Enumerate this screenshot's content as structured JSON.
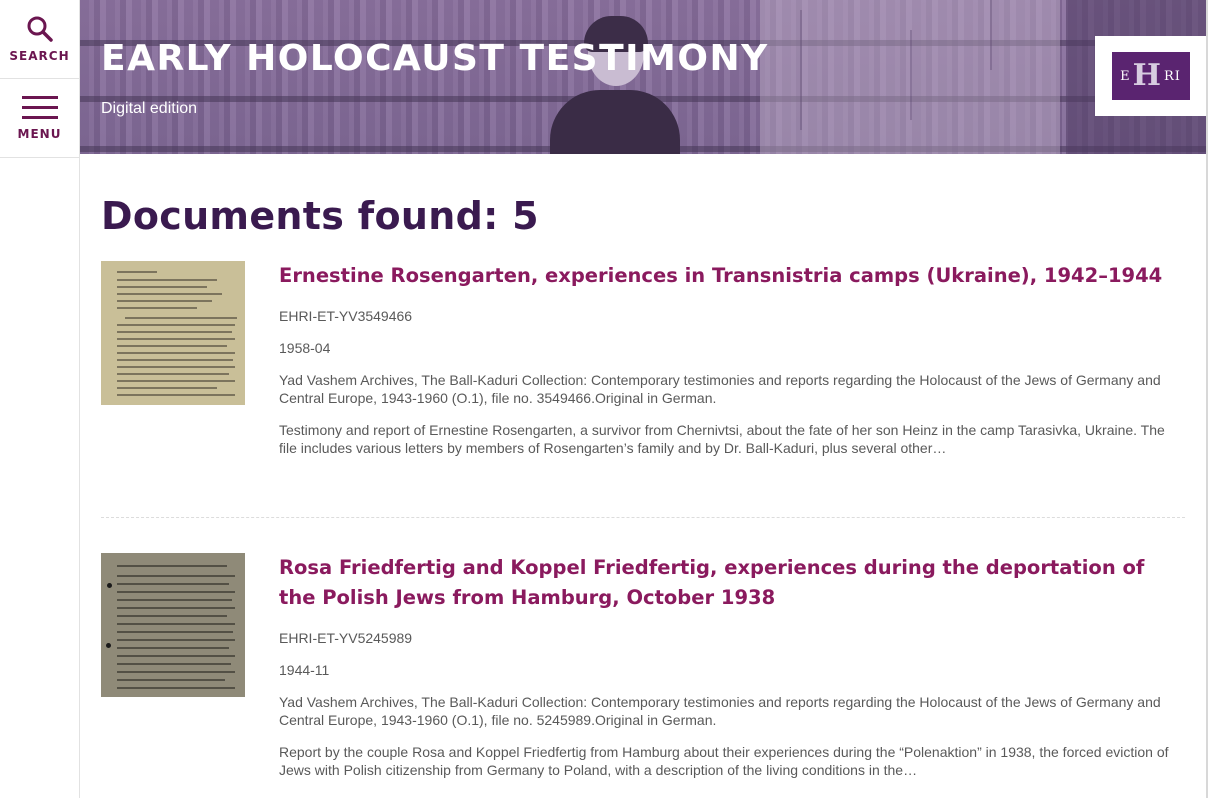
{
  "nav": {
    "search_label": "SEARCH",
    "menu_label": "MENU"
  },
  "header": {
    "title": "EARLY HOLOCAUST TESTIMONY",
    "subtitle": "Digital edition",
    "logo_text_left": "E",
    "logo_text_mid": "H",
    "logo_text_right": "RI"
  },
  "colors": {
    "accent": "#8a1a5e",
    "heading": "#3a1a4f",
    "banner": "#8c6ea0"
  },
  "results": {
    "heading": "Documents found: 5",
    "items": [
      {
        "title": "Ernestine Rosengarten, experiences in Transnistria camps (Ukraine), 1942–1944",
        "id": "EHRI-ET-YV3549466",
        "date": "1958-04",
        "source": "Yad Vashem Archives, The Ball-Kaduri Collection: Contemporary testimonies and reports regarding the Holocaust of the Jews of Germany and Central Europe, 1943-1960 (O.1), file no. 3549466.Original in German.",
        "summary": "Testimony and report of Ernestine Rosengarten, a survivor from Chernivtsi, about the fate of her son Heinz in the camp Tarasivka, Ukraine. The file includes various letters by members of Rosengarten’s family and by Dr. Ball-Kaduri, plus several other…"
      },
      {
        "title": "Rosa Friedfertig and Koppel Friedfertig, experiences during the deportation of the Polish Jews from Hamburg, October 1938",
        "id": "EHRI-ET-YV5245989",
        "date": "1944-11",
        "source": "Yad Vashem Archives, The Ball-Kaduri Collection: Contemporary testimonies and reports regarding the Holocaust of the Jews of Germany and Central Europe, 1943-1960 (O.1), file no. 5245989.Original in German.",
        "summary": "Report by the couple Rosa and Koppel Friedfertig from Hamburg about their experiences during the “Polenaktion” in 1938, the forced eviction of Jews with Polish citizenship from Germany to Poland, with a description of the living conditions in the…"
      }
    ]
  }
}
